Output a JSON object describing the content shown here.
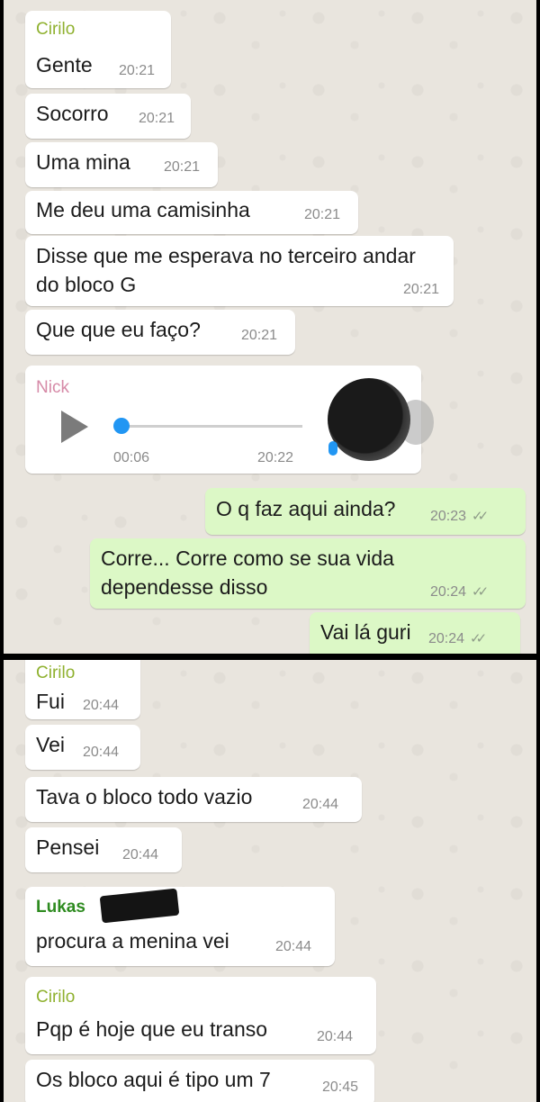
{
  "colors": {
    "incoming_bubble": "#ffffff",
    "outgoing_bubble": "#dcf8c6",
    "chat_background": "#e9e5de",
    "cirilo_name": "#8fb12f",
    "nick_name": "#d68aa7",
    "lukas_name": "#2e8b20",
    "voice_accent": "#2196f3"
  },
  "panel1": {
    "group1": {
      "sender": "Cirilo",
      "messages": [
        {
          "text": "Gente",
          "time": "20:21"
        },
        {
          "text": "Socorro",
          "time": "20:21"
        },
        {
          "text": "Uma mina",
          "time": "20:21"
        },
        {
          "text": "Me deu uma camisinha",
          "time": "20:21"
        },
        {
          "text": "Disse que me esperava no terceiro andar do bloco G",
          "time": "20:21"
        },
        {
          "text": "Que que eu faço?",
          "time": "20:21"
        }
      ]
    },
    "voice": {
      "sender": "Nick",
      "duration": "00:06",
      "time": "20:22",
      "progress": 0,
      "icons": [
        "play-icon",
        "mic-icon",
        "avatar"
      ]
    },
    "outgoing": [
      {
        "text": "O q faz aqui ainda?",
        "time": "20:23",
        "status": "double-check-icon"
      },
      {
        "text": "Corre... Corre como se sua vida dependesse disso",
        "time": "20:24",
        "status": "double-check-icon"
      },
      {
        "text": "Vai lá guri",
        "time": "20:24",
        "status": "double-check-icon"
      }
    ]
  },
  "panel2": {
    "group1": {
      "sender": "Cirilo",
      "messages": [
        {
          "text": "Fui",
          "time": "20:44"
        },
        {
          "text": "Vei",
          "time": "20:44"
        },
        {
          "text": "Tava o bloco todo vazio",
          "time": "20:44"
        },
        {
          "text": "Pensei",
          "time": "20:44"
        }
      ]
    },
    "group2": {
      "sender": "Lukas",
      "messages": [
        {
          "text": "procura a menina vei",
          "time": "20:44"
        }
      ]
    },
    "group3": {
      "sender": "Cirilo",
      "messages": [
        {
          "text": "Pqp é hoje que eu transo",
          "time": "20:44"
        },
        {
          "text": "Os bloco aqui é tipo um 7",
          "time": "20:45"
        }
      ]
    }
  }
}
